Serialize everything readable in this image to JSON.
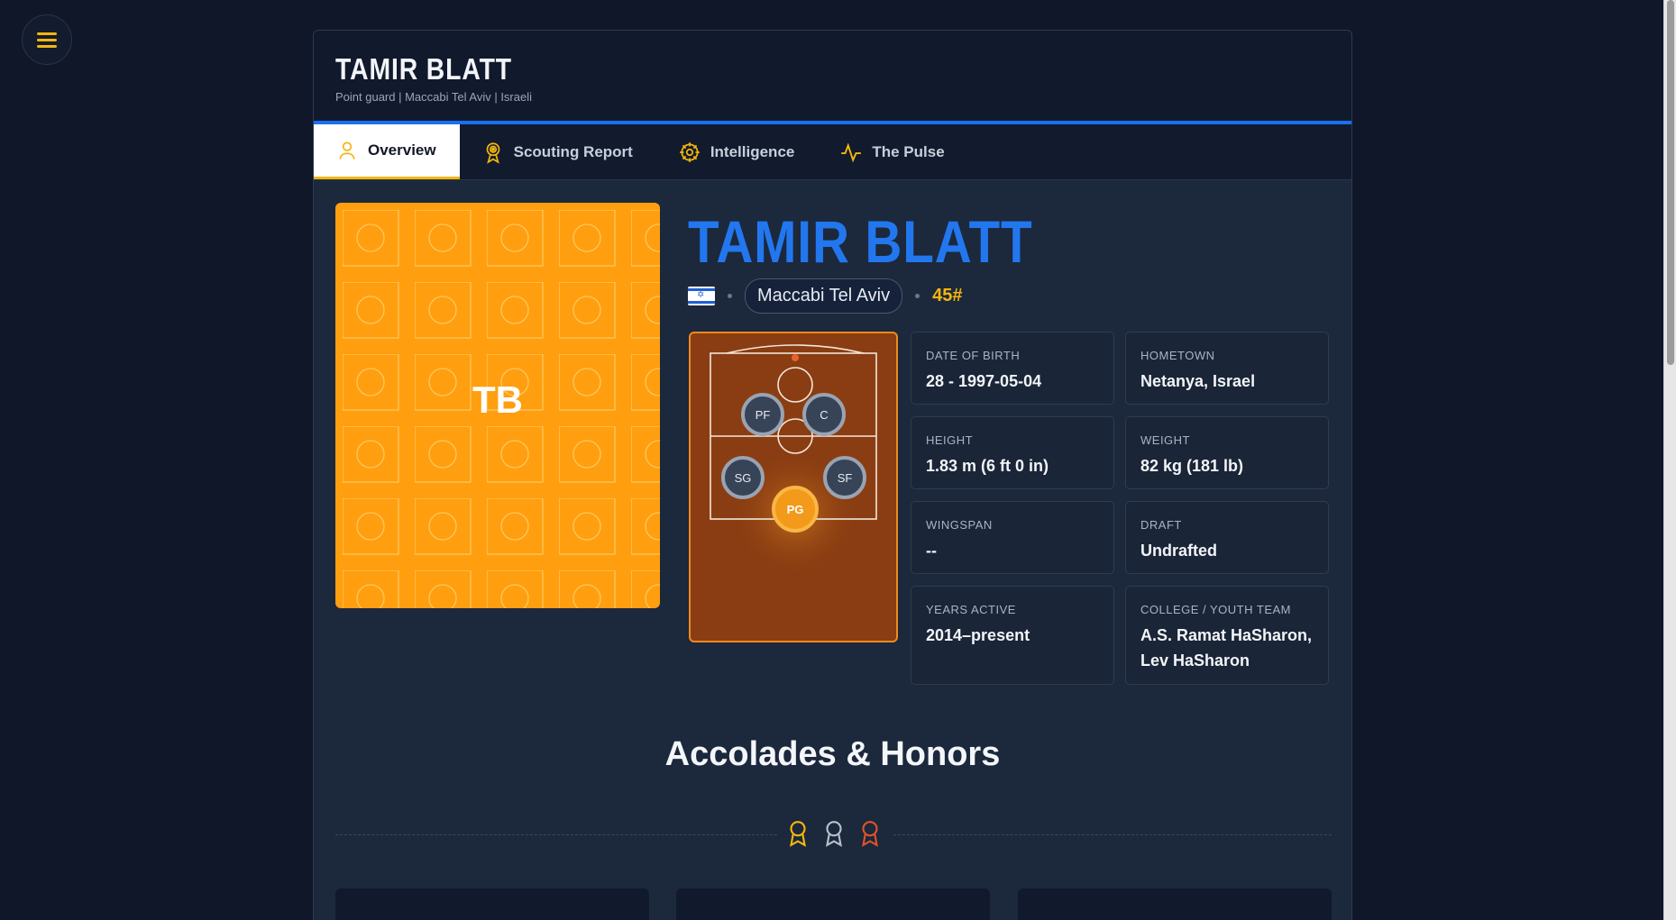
{
  "page": {
    "menu_icon": "hamburger-icon",
    "header": {
      "title": "TAMIR BLATT",
      "subtitle": "Point guard | Maccabi Tel Aviv | Israeli"
    },
    "tabs": [
      {
        "label": "Overview",
        "icon": "person-icon",
        "active": true
      },
      {
        "label": "Scouting Report",
        "icon": "target-icon",
        "active": false
      },
      {
        "label": "Intelligence",
        "icon": "brain-icon",
        "active": false
      },
      {
        "label": "The Pulse",
        "icon": "pulse-icon",
        "active": false
      }
    ]
  },
  "player": {
    "initials": "TB",
    "name": "TAMIR BLATT",
    "flag": "israel-flag-icon",
    "team": "Maccabi Tel Aviv",
    "jersey": "45#",
    "positions": [
      {
        "code": "PF",
        "active": false
      },
      {
        "code": "C",
        "active": false
      },
      {
        "code": "SG",
        "active": false
      },
      {
        "code": "SF",
        "active": false
      },
      {
        "code": "PG",
        "active": true
      }
    ],
    "stats": {
      "dob": {
        "label": "DATE OF BIRTH",
        "value": "28 - 1997-05-04"
      },
      "hometown": {
        "label": "HOMETOWN",
        "value": "Netanya, Israel"
      },
      "height": {
        "label": "HEIGHT",
        "value": "1.83 m (6 ft 0 in)"
      },
      "weight": {
        "label": "WEIGHT",
        "value": "82 kg (181 lb)"
      },
      "wingspan": {
        "label": "WINGSPAN",
        "value": "--"
      },
      "draft": {
        "label": "DRAFT",
        "value": "Undrafted"
      },
      "years": {
        "label": "YEARS ACTIVE",
        "value": "2014–present"
      },
      "college": {
        "label": "COLLEGE / YOUTH TEAM",
        "value": "A.S. Ramat HaSharon, Lev HaSharon"
      }
    }
  },
  "accolades": {
    "title": "Accolades & Honors",
    "medal_icons": [
      "gold-medal-icon",
      "silver-medal-icon",
      "bronze-medal-icon"
    ]
  },
  "colors": {
    "accent_blue": "#2277ee",
    "accent_gold": "#f5b60e",
    "photo_orange": "#ff9f0f",
    "court_brown": "#8a3d12"
  }
}
